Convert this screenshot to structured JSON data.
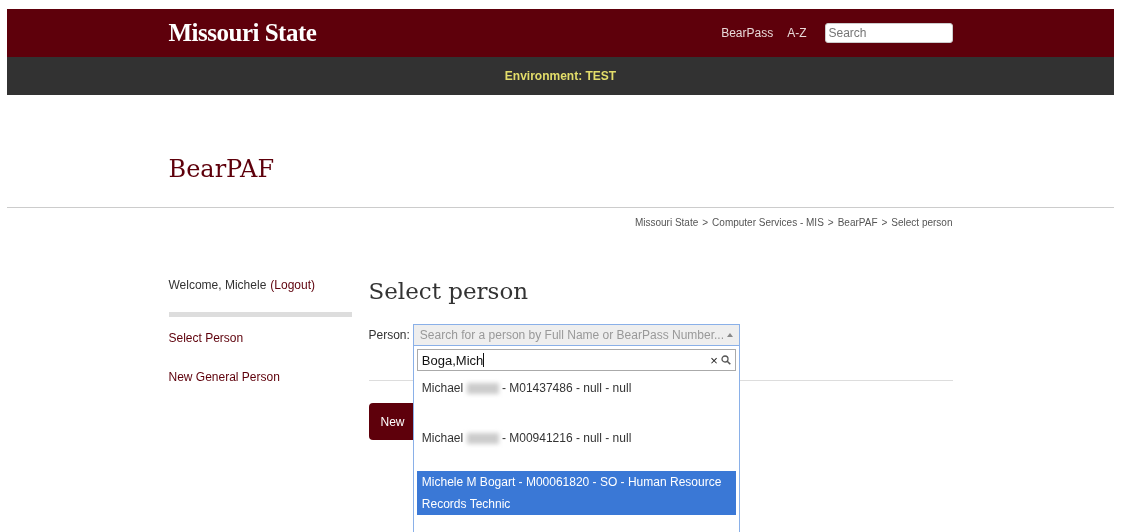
{
  "header": {
    "logo": "Missouri State",
    "links": [
      "BearPass",
      "A-Z"
    ],
    "search": {
      "placeholder": "Search"
    }
  },
  "environment_bar": "Environment: TEST",
  "app_title": "BearPAF",
  "breadcrumb": [
    "Missouri State",
    "Computer Services - MIS",
    "BearPAF",
    "Select person"
  ],
  "breadcrumb_separator": ">",
  "sidebar": {
    "welcome": "Welcome, Michele",
    "logout": "(Logout)",
    "items": [
      {
        "label": "Select Person"
      },
      {
        "label": "New General Person"
      }
    ]
  },
  "main": {
    "heading": "Select person",
    "person_label": "Person:",
    "select": {
      "placeholder": "Search for a person by Full Name or BearPass Number...",
      "expanded": true,
      "search_value": "Boga,Mich",
      "clear": "×",
      "options": [
        {
          "name": "Michael",
          "redacted": true,
          "detail": "- M01437486 - null - null",
          "selected": false
        },
        {
          "name": "Michael",
          "redacted": true,
          "detail": "- M00941216 - null - null",
          "selected": false
        },
        {
          "name": "Michele M Bogart",
          "redacted": false,
          "detail": "- M00061820 - SO - Human Resource Records Technic",
          "selected": true
        }
      ]
    },
    "button": "New"
  }
}
